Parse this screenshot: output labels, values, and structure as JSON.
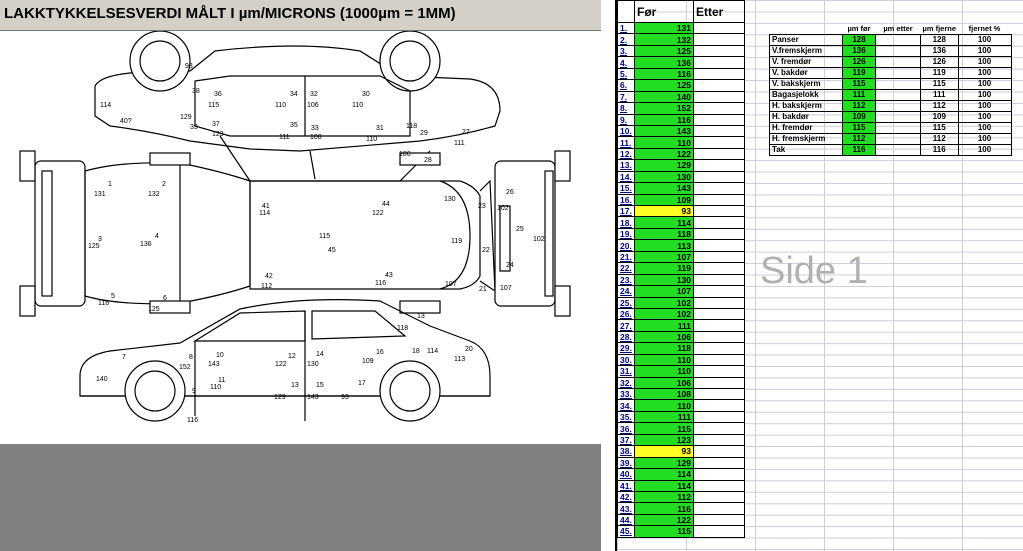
{
  "title": "LAKKTYKKELSESVERDI MÅLT I µm/MICRONS (1000µm = 1MM)",
  "side_label": "Side 1",
  "table_headers": {
    "before": "Før",
    "after": "Etter"
  },
  "measurements": [
    {
      "n": "1.",
      "v": "131",
      "c": "g"
    },
    {
      "n": "2.",
      "v": "132",
      "c": "g"
    },
    {
      "n": "3.",
      "v": "125",
      "c": "g"
    },
    {
      "n": "4.",
      "v": "136",
      "c": "g"
    },
    {
      "n": "5.",
      "v": "116",
      "c": "g"
    },
    {
      "n": "6.",
      "v": "125",
      "c": "g"
    },
    {
      "n": "7.",
      "v": "140",
      "c": "g"
    },
    {
      "n": "8.",
      "v": "152",
      "c": "g"
    },
    {
      "n": "9.",
      "v": "116",
      "c": "g"
    },
    {
      "n": "10.",
      "v": "143",
      "c": "g"
    },
    {
      "n": "11.",
      "v": "110",
      "c": "g"
    },
    {
      "n": "12.",
      "v": "122",
      "c": "g"
    },
    {
      "n": "13.",
      "v": "129",
      "c": "g"
    },
    {
      "n": "14.",
      "v": "130",
      "c": "g"
    },
    {
      "n": "15.",
      "v": "143",
      "c": "g"
    },
    {
      "n": "16.",
      "v": "109",
      "c": "g"
    },
    {
      "n": "17.",
      "v": "93",
      "c": "y"
    },
    {
      "n": "18.",
      "v": "114",
      "c": "g"
    },
    {
      "n": "19.",
      "v": "118",
      "c": "g"
    },
    {
      "n": "20.",
      "v": "113",
      "c": "g"
    },
    {
      "n": "21.",
      "v": "107",
      "c": "g"
    },
    {
      "n": "22.",
      "v": "119",
      "c": "g"
    },
    {
      "n": "23.",
      "v": "130",
      "c": "g"
    },
    {
      "n": "24.",
      "v": "107",
      "c": "g"
    },
    {
      "n": "25.",
      "v": "102",
      "c": "g"
    },
    {
      "n": "26.",
      "v": "102",
      "c": "g"
    },
    {
      "n": "27.",
      "v": "111",
      "c": "g"
    },
    {
      "n": "28.",
      "v": "106",
      "c": "g"
    },
    {
      "n": "29.",
      "v": "118",
      "c": "g"
    },
    {
      "n": "30.",
      "v": "110",
      "c": "g"
    },
    {
      "n": "31.",
      "v": "110",
      "c": "g"
    },
    {
      "n": "32.",
      "v": "106",
      "c": "g"
    },
    {
      "n": "33.",
      "v": "108",
      "c": "g"
    },
    {
      "n": "34.",
      "v": "110",
      "c": "g"
    },
    {
      "n": "35.",
      "v": "111",
      "c": "g"
    },
    {
      "n": "36.",
      "v": "115",
      "c": "g"
    },
    {
      "n": "37.",
      "v": "123",
      "c": "g"
    },
    {
      "n": "38.",
      "v": "93",
      "c": "y"
    },
    {
      "n": "39.",
      "v": "129",
      "c": "g"
    },
    {
      "n": "40.",
      "v": "114",
      "c": "g"
    },
    {
      "n": "41.",
      "v": "114",
      "c": "g"
    },
    {
      "n": "42.",
      "v": "112",
      "c": "g"
    },
    {
      "n": "43.",
      "v": "116",
      "c": "g"
    },
    {
      "n": "44.",
      "v": "122",
      "c": "g"
    },
    {
      "n": "45.",
      "v": "115",
      "c": "g"
    }
  ],
  "summary_headers": {
    "before": "µm før",
    "after": "µm etter",
    "removed": "µm fjerne",
    "removed_pct": "fjernet %"
  },
  "summary": [
    {
      "part": "Panser",
      "before": "128",
      "removed": "128",
      "pct": "100"
    },
    {
      "part": "V.fremskjerm",
      "before": "136",
      "removed": "136",
      "pct": "100"
    },
    {
      "part": "V. fremdør",
      "before": "126",
      "removed": "126",
      "pct": "100"
    },
    {
      "part": "V. bakdør",
      "before": "119",
      "removed": "119",
      "pct": "100"
    },
    {
      "part": "V. bakskjerm",
      "before": "115",
      "removed": "115",
      "pct": "100"
    },
    {
      "part": "Bagasjelokk",
      "before": "111",
      "removed": "111",
      "pct": "100"
    },
    {
      "part": "H. bakskjerm",
      "before": "112",
      "removed": "112",
      "pct": "100"
    },
    {
      "part": "H. bakdør",
      "before": "109",
      "removed": "109",
      "pct": "100"
    },
    {
      "part": "H. fremdør",
      "before": "115",
      "removed": "115",
      "pct": "100"
    },
    {
      "part": "H. fremskjerm",
      "before": "112",
      "removed": "112",
      "pct": "100"
    },
    {
      "part": "Tak",
      "before": "116",
      "removed": "116",
      "pct": "100"
    }
  ],
  "diagram_labels": {
    "top": [
      {
        "t": "93"
      },
      {
        "t": "38"
      },
      {
        "t": "36"
      },
      {
        "t": "34"
      },
      {
        "t": "32"
      },
      {
        "t": "30"
      },
      {
        "t": "114"
      },
      {
        "t": "115"
      },
      {
        "t": "110"
      },
      {
        "t": "106"
      },
      {
        "t": "110"
      },
      {
        "t": "40?"
      },
      {
        "t": "129"
      },
      {
        "t": "39"
      },
      {
        "t": "37"
      },
      {
        "t": "35"
      },
      {
        "t": "33"
      },
      {
        "t": "31"
      },
      {
        "t": "118"
      },
      {
        "t": "123"
      },
      {
        "t": "111"
      },
      {
        "t": "108"
      },
      {
        "t": "110"
      },
      {
        "t": "29"
      },
      {
        "t": "27"
      },
      {
        "t": "111"
      },
      {
        "t": "106"
      },
      {
        "t": "28"
      }
    ],
    "middle": [
      {
        "t": "1"
      },
      {
        "t": "2"
      },
      {
        "t": "131"
      },
      {
        "t": "132"
      },
      {
        "t": "3"
      },
      {
        "t": "4"
      },
      {
        "t": "125"
      },
      {
        "t": "136"
      },
      {
        "t": "5"
      },
      {
        "t": "6"
      },
      {
        "t": "116"
      },
      {
        "t": "125"
      },
      {
        "t": "41"
      },
      {
        "t": "114"
      },
      {
        "t": "44"
      },
      {
        "t": "122"
      },
      {
        "t": "115"
      },
      {
        "t": "45"
      },
      {
        "t": "42"
      },
      {
        "t": "112"
      },
      {
        "t": "43"
      },
      {
        "t": "116"
      },
      {
        "t": "130"
      },
      {
        "t": "23"
      },
      {
        "t": "119"
      },
      {
        "t": "22"
      },
      {
        "t": "107"
      },
      {
        "t": "21"
      },
      {
        "t": "26"
      },
      {
        "t": "102"
      },
      {
        "t": "25"
      },
      {
        "t": "24"
      },
      {
        "t": "102"
      },
      {
        "t": "107"
      }
    ],
    "bottom": [
      {
        "t": "13"
      },
      {
        "t": "118"
      },
      {
        "t": "7"
      },
      {
        "t": "8"
      },
      {
        "t": "152"
      },
      {
        "t": "10"
      },
      {
        "t": "143"
      },
      {
        "t": "12"
      },
      {
        "t": "122"
      },
      {
        "t": "14"
      },
      {
        "t": "130"
      },
      {
        "t": "16"
      },
      {
        "t": "109"
      },
      {
        "t": "18"
      },
      {
        "t": "114"
      },
      {
        "t": "20"
      },
      {
        "t": "113"
      },
      {
        "t": "140"
      },
      {
        "t": "9"
      },
      {
        "t": "11"
      },
      {
        "t": "110"
      },
      {
        "t": "13"
      },
      {
        "t": "129"
      },
      {
        "t": "15"
      },
      {
        "t": "143"
      },
      {
        "t": "93"
      },
      {
        "t": "17"
      },
      {
        "t": "116"
      }
    ]
  },
  "colors": {
    "green": "#22dd22",
    "yellow": "#ffff22",
    "link": "#000080"
  }
}
